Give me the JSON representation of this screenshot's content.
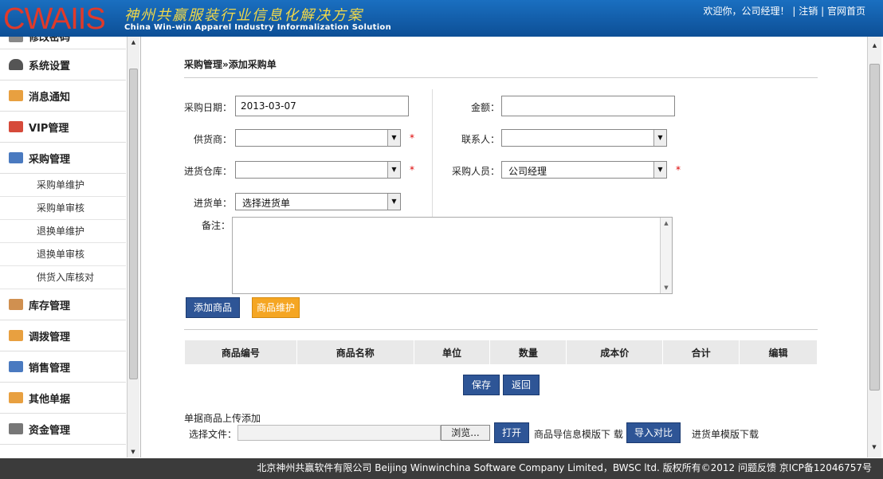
{
  "header": {
    "logo": "CWAIIS",
    "logo_cn": "神州共赢服装行业信息化解决方案",
    "logo_en": "China Win-win Apparel Industry Informalization Solution",
    "welcome": "欢迎你，公司经理！",
    "logout": "注销",
    "home": "官网首页",
    "sep": "|"
  },
  "sidebar": {
    "cut_item": "修改密码",
    "items": [
      {
        "label": "系统设置",
        "icon": "shield-icon",
        "color": "#555"
      },
      {
        "label": "消息通知",
        "icon": "envelope-icon",
        "color": "#e8a040"
      },
      {
        "label": "VIP管理",
        "icon": "calendar-icon",
        "color": "#d64a3a"
      },
      {
        "label": "采购管理",
        "icon": "truck-icon",
        "color": "#4a7ac0"
      }
    ],
    "sub_items": [
      "采购单维护",
      "采购单审核",
      "退换单维护",
      "退换单审核",
      "供货入库核对"
    ],
    "items2": [
      {
        "label": "库存管理",
        "icon": "box-icon",
        "color": "#d09050"
      },
      {
        "label": "调拨管理",
        "icon": "envelope-icon",
        "color": "#e8a040"
      },
      {
        "label": "销售管理",
        "icon": "truck-icon",
        "color": "#4a7ac0"
      },
      {
        "label": "其他单据",
        "icon": "envelope-icon",
        "color": "#e8a040"
      },
      {
        "label": "资金管理",
        "icon": "money-icon",
        "color": "#777"
      }
    ]
  },
  "main": {
    "breadcrumb": "采购管理»添加采购单",
    "form": {
      "date_label": "采购日期：",
      "date_value": "2013-03-07",
      "amount_label": "金额：",
      "amount_value": "",
      "supplier_label": "供货商：",
      "supplier_value": "",
      "contact_label": "联系人：",
      "contact_value": "",
      "warehouse_label": "进货仓库：",
      "warehouse_value": "",
      "buyer_label": "采购人员：",
      "buyer_value": "公司经理",
      "order_label": "进货单：",
      "order_value": "选择进货单",
      "note_label": "备注：",
      "required": "*"
    },
    "buttons": {
      "add_goods": "添加商品",
      "goods_maint": "商品维护",
      "save": "保存",
      "back": "返回"
    },
    "table": {
      "headers": [
        "商品编号",
        "商品名称",
        "单位",
        "数量",
        "成本价",
        "合计",
        "编辑"
      ]
    },
    "upload": {
      "title": "单据商品上传添加",
      "file_label": "选择文件：",
      "browse": "浏览...",
      "open": "打开",
      "template_goods": "商品导信息模版下 载",
      "import": "导入对比",
      "template_order": "进货单模版下载"
    }
  },
  "footer": {
    "text": "北京神州共赢软件有限公司 Beijing Winwinchina Software Company Limited，BWSC ltd.   版权所有©2012  问题反馈   京ICP备12046757号"
  }
}
